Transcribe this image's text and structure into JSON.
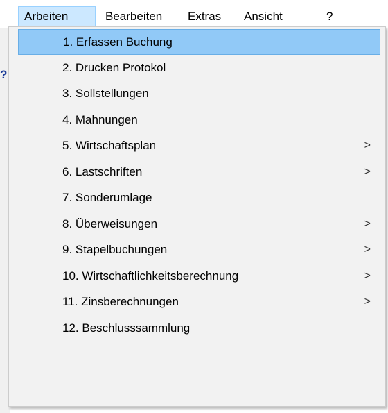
{
  "menubar": {
    "items": [
      {
        "label": "Arbeiten"
      },
      {
        "label": "Bearbeiten"
      },
      {
        "label": "Extras"
      },
      {
        "label": "Ansicht"
      },
      {
        "label": "?"
      }
    ]
  },
  "background": {
    "question_glyph": "?"
  },
  "dropdown": {
    "submenu_arrow": ">",
    "items": [
      {
        "label": "1. Erfassen Buchung",
        "has_submenu": false,
        "highlighted": true
      },
      {
        "label": "2. Drucken Protokol",
        "has_submenu": false
      },
      {
        "label": "3. Sollstellungen",
        "has_submenu": false
      },
      {
        "label": "4. Mahnungen",
        "has_submenu": false
      },
      {
        "label": "5. Wirtschaftsplan",
        "has_submenu": true
      },
      {
        "label": "6. Lastschriften",
        "has_submenu": true
      },
      {
        "label": "7. Sonderumlage",
        "has_submenu": false
      },
      {
        "label": "8. Überweisungen",
        "has_submenu": true
      },
      {
        "label": "9. Stapelbuchungen",
        "has_submenu": true
      },
      {
        "label": "10. Wirtschaftlichkeitsberechnung",
        "has_submenu": true
      },
      {
        "label": "11. Zinsberechnungen",
        "has_submenu": true
      },
      {
        "label": "12. Beschlusssammlung",
        "has_submenu": false
      }
    ]
  },
  "colors": {
    "highlight": "#91c9f7",
    "menu_background": "#f2f2f2",
    "active_menubar": "#cce8ff"
  }
}
